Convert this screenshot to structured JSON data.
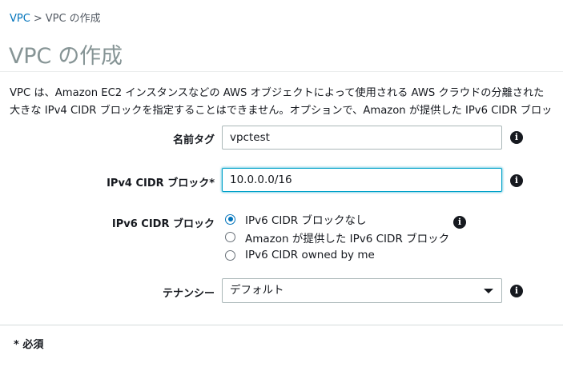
{
  "breadcrumb": {
    "root": "VPC",
    "separator": ">",
    "current": "VPC の作成"
  },
  "page_title": "VPC の作成",
  "description": {
    "line1": "VPC は、Amazon EC2 インスタンスなどの AWS オブジェクトによって使用される AWS クラウドの分離された",
    "line2": "大きな IPv4 CIDR ブロックを指定することはできません。オプションで、Amazon が提供した IPv6 CIDR ブロッ"
  },
  "form": {
    "name_tag": {
      "label": "名前タグ",
      "value": "vpctest",
      "info_icon": "info-icon"
    },
    "ipv4_cidr": {
      "label": "IPv4 CIDR ブロック*",
      "value": "10.0.0.0/16",
      "focused": true,
      "info_icon": "info-icon"
    },
    "ipv6_cidr": {
      "label": "IPv6 CIDR ブロック",
      "options": [
        {
          "label": "IPv6 CIDR ブロックなし",
          "checked": true
        },
        {
          "label": "Amazon が提供した IPv6 CIDR ブロック",
          "checked": false
        },
        {
          "label": "IPv6 CIDR owned by me",
          "checked": false
        }
      ],
      "info_icon": "info-icon"
    },
    "tenancy": {
      "label": "テナンシー",
      "selected": "デフォルト",
      "info_icon": "info-icon"
    }
  },
  "required_note": "* 必須",
  "colors": {
    "link": "#0073bb",
    "title": "#879596",
    "focus_border": "#00a1c9",
    "radio_checked": "#0073bb"
  }
}
